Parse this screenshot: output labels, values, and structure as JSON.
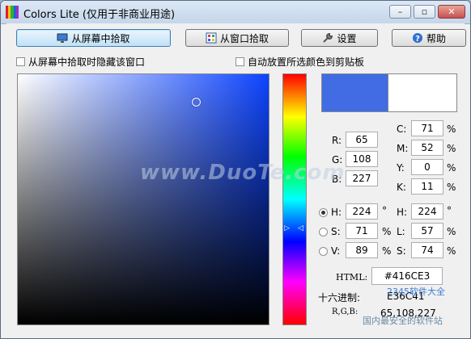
{
  "window": {
    "title": "Colors Lite (仅用于非商业用途)",
    "min_glyph": "–",
    "max_glyph": "▫",
    "close_glyph": "✕"
  },
  "toolbar": {
    "pick_screen": "从屏幕中拾取",
    "pick_window": "从窗口拾取",
    "settings": "设置",
    "help": "帮助"
  },
  "options": {
    "hide_on_pick": "从屏幕中拾取时隐藏该窗口",
    "auto_copy": "自动放置所选颜色到剪贴板"
  },
  "colors": {
    "current": "#416CE3",
    "previous": "#FFFFFF"
  },
  "rgb": {
    "r_label": "R:",
    "r": "65",
    "g_label": "G:",
    "g": "108",
    "b_label": "B:",
    "b": "227"
  },
  "cmyk": {
    "c_label": "C:",
    "c": "71",
    "m_label": "M:",
    "m": "52",
    "y_label": "Y:",
    "y": "0",
    "k_label": "K:",
    "k": "11",
    "unit": "%"
  },
  "hsv": {
    "h_label": "H:",
    "h": "224",
    "h_unit": "°",
    "s_label": "S:",
    "s": "71",
    "s_unit": "%",
    "v_label": "V:",
    "v": "89",
    "v_unit": "%"
  },
  "hsl": {
    "h_label": "H:",
    "h": "224",
    "h_unit": "°",
    "l_label": "L:",
    "l": "57",
    "l_unit": "%",
    "s_label": "S:",
    "s": "74",
    "s_unit": "%"
  },
  "outputs": {
    "html_label": "HTML:",
    "html_value": "#416CE3",
    "hex_label": "十六进制:",
    "hex_value": "E36C41",
    "rgb_label": "R,G,B:",
    "rgb_value": "65,108,227"
  },
  "watermark": {
    "main": "www.DuoTe.com",
    "corner1": "2345软件大全",
    "corner2": "国内最安全的软件站"
  }
}
